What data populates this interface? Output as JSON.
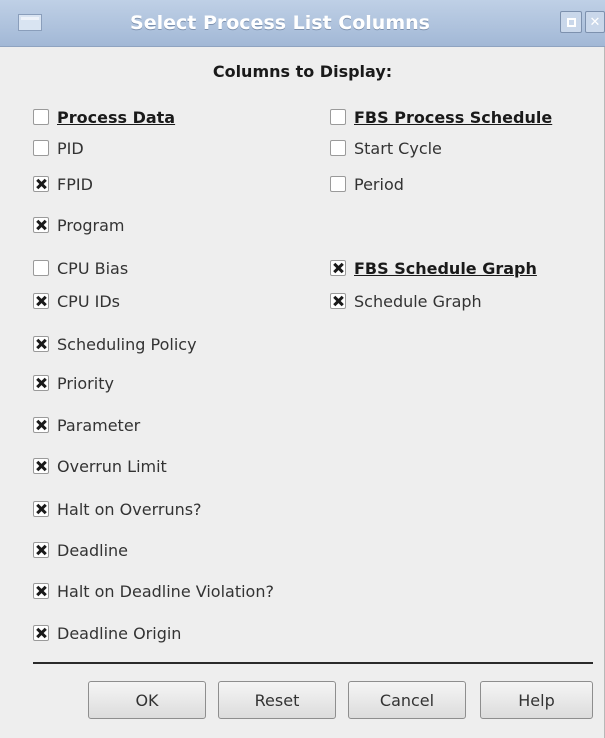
{
  "window": {
    "title": "Select Process List Columns"
  },
  "heading": "Columns to Display:",
  "left_column": [
    {
      "label": "Process Data",
      "checked": false,
      "header": true
    },
    {
      "label": "PID",
      "checked": false
    },
    {
      "label": "FPID",
      "checked": true
    },
    {
      "label": "Program",
      "checked": true
    },
    {
      "label": "CPU Bias",
      "checked": false
    },
    {
      "label": "CPU IDs",
      "checked": true
    },
    {
      "label": "Scheduling Policy",
      "checked": true
    },
    {
      "label": "Priority",
      "checked": true
    },
    {
      "label": "Parameter",
      "checked": true
    },
    {
      "label": "Overrun Limit",
      "checked": true
    },
    {
      "label": "Halt on Overruns?",
      "checked": true
    },
    {
      "label": "Deadline",
      "checked": true
    },
    {
      "label": "Halt on Deadline Violation?",
      "checked": true
    },
    {
      "label": "Deadline Origin",
      "checked": true
    }
  ],
  "right_column": [
    {
      "label": "FBS Process Schedule",
      "checked": false,
      "header": true
    },
    {
      "label": "Start Cycle",
      "checked": false
    },
    {
      "label": "Period",
      "checked": false
    },
    {
      "label": "FBS Schedule Graph",
      "checked": true,
      "header": true
    },
    {
      "label": "Schedule Graph",
      "checked": true
    }
  ],
  "buttons": {
    "ok": "OK",
    "reset": "Reset",
    "cancel": "Cancel",
    "help": "Help"
  }
}
